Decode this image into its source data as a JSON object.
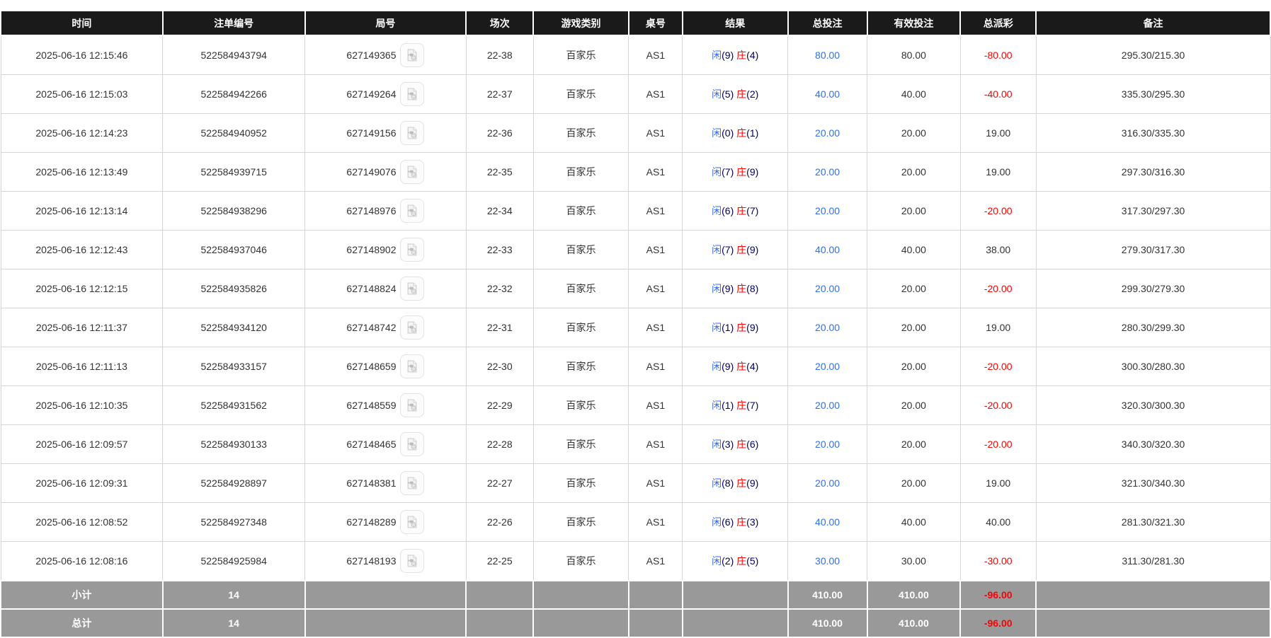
{
  "header": {
    "columns": [
      "时间",
      "注单编号",
      "局号",
      "场次",
      "游戏类别",
      "桌号",
      "结果",
      "总投注",
      "有效投注",
      "总派彩",
      "备注"
    ]
  },
  "result_labels": {
    "player": "闲",
    "banker": "庄"
  },
  "rows": [
    {
      "time": "2025-06-16 12:15:46",
      "bet_id": "522584943794",
      "round_id": "627149365",
      "session": "22-38",
      "game": "百家乐",
      "table_id": "AS1",
      "player": "9",
      "banker": "4",
      "total_bet": "80.00",
      "valid_bet": "80.00",
      "payout": "-80.00",
      "remark": "295.30/215.30"
    },
    {
      "time": "2025-06-16 12:15:03",
      "bet_id": "522584942266",
      "round_id": "627149264",
      "session": "22-37",
      "game": "百家乐",
      "table_id": "AS1",
      "player": "5",
      "banker": "2",
      "total_bet": "40.00",
      "valid_bet": "40.00",
      "payout": "-40.00",
      "remark": "335.30/295.30"
    },
    {
      "time": "2025-06-16 12:14:23",
      "bet_id": "522584940952",
      "round_id": "627149156",
      "session": "22-36",
      "game": "百家乐",
      "table_id": "AS1",
      "player": "0",
      "banker": "1",
      "total_bet": "20.00",
      "valid_bet": "20.00",
      "payout": "19.00",
      "remark": "316.30/335.30"
    },
    {
      "time": "2025-06-16 12:13:49",
      "bet_id": "522584939715",
      "round_id": "627149076",
      "session": "22-35",
      "game": "百家乐",
      "table_id": "AS1",
      "player": "7",
      "banker": "9",
      "total_bet": "20.00",
      "valid_bet": "20.00",
      "payout": "19.00",
      "remark": "297.30/316.30"
    },
    {
      "time": "2025-06-16 12:13:14",
      "bet_id": "522584938296",
      "round_id": "627148976",
      "session": "22-34",
      "game": "百家乐",
      "table_id": "AS1",
      "player": "6",
      "banker": "7",
      "total_bet": "20.00",
      "valid_bet": "20.00",
      "payout": "-20.00",
      "remark": "317.30/297.30"
    },
    {
      "time": "2025-06-16 12:12:43",
      "bet_id": "522584937046",
      "round_id": "627148902",
      "session": "22-33",
      "game": "百家乐",
      "table_id": "AS1",
      "player": "7",
      "banker": "9",
      "total_bet": "40.00",
      "valid_bet": "40.00",
      "payout": "38.00",
      "remark": "279.30/317.30"
    },
    {
      "time": "2025-06-16 12:12:15",
      "bet_id": "522584935826",
      "round_id": "627148824",
      "session": "22-32",
      "game": "百家乐",
      "table_id": "AS1",
      "player": "9",
      "banker": "8",
      "total_bet": "20.00",
      "valid_bet": "20.00",
      "payout": "-20.00",
      "remark": "299.30/279.30"
    },
    {
      "time": "2025-06-16 12:11:37",
      "bet_id": "522584934120",
      "round_id": "627148742",
      "session": "22-31",
      "game": "百家乐",
      "table_id": "AS1",
      "player": "1",
      "banker": "9",
      "total_bet": "20.00",
      "valid_bet": "20.00",
      "payout": "19.00",
      "remark": "280.30/299.30"
    },
    {
      "time": "2025-06-16 12:11:13",
      "bet_id": "522584933157",
      "round_id": "627148659",
      "session": "22-30",
      "game": "百家乐",
      "table_id": "AS1",
      "player": "9",
      "banker": "4",
      "total_bet": "20.00",
      "valid_bet": "20.00",
      "payout": "-20.00",
      "remark": "300.30/280.30"
    },
    {
      "time": "2025-06-16 12:10:35",
      "bet_id": "522584931562",
      "round_id": "627148559",
      "session": "22-29",
      "game": "百家乐",
      "table_id": "AS1",
      "player": "1",
      "banker": "7",
      "total_bet": "20.00",
      "valid_bet": "20.00",
      "payout": "-20.00",
      "remark": "320.30/300.30"
    },
    {
      "time": "2025-06-16 12:09:57",
      "bet_id": "522584930133",
      "round_id": "627148465",
      "session": "22-28",
      "game": "百家乐",
      "table_id": "AS1",
      "player": "3",
      "banker": "6",
      "total_bet": "20.00",
      "valid_bet": "20.00",
      "payout": "-20.00",
      "remark": "340.30/320.30"
    },
    {
      "time": "2025-06-16 12:09:31",
      "bet_id": "522584928897",
      "round_id": "627148381",
      "session": "22-27",
      "game": "百家乐",
      "table_id": "AS1",
      "player": "8",
      "banker": "9",
      "total_bet": "20.00",
      "valid_bet": "20.00",
      "payout": "19.00",
      "remark": "321.30/340.30"
    },
    {
      "time": "2025-06-16 12:08:52",
      "bet_id": "522584927348",
      "round_id": "627148289",
      "session": "22-26",
      "game": "百家乐",
      "table_id": "AS1",
      "player": "6",
      "banker": "3",
      "total_bet": "40.00",
      "valid_bet": "40.00",
      "payout": "40.00",
      "remark": "281.30/321.30"
    },
    {
      "time": "2025-06-16 12:08:16",
      "bet_id": "522584925984",
      "round_id": "627148193",
      "session": "22-25",
      "game": "百家乐",
      "table_id": "AS1",
      "player": "2",
      "banker": "5",
      "total_bet": "30.00",
      "valid_bet": "30.00",
      "payout": "-30.00",
      "remark": "311.30/281.30"
    }
  ],
  "footer": [
    {
      "label": "小计",
      "count": "14",
      "total_bet": "410.00",
      "valid_bet": "410.00",
      "payout": "-96.00"
    },
    {
      "label": "总计",
      "count": "14",
      "total_bet": "410.00",
      "valid_bet": "410.00",
      "payout": "-96.00"
    }
  ],
  "icons": {
    "round_replay": "video-replay-icon"
  },
  "colors": {
    "header_bg": "#1a1a1a",
    "footer_bg": "#999999",
    "bet_blue": "#2f6ff2",
    "player_blue": "#3b6af0",
    "banker_red": "#ff0000",
    "negative_red": "#ff0000",
    "row_border": "#d6d6d6"
  }
}
